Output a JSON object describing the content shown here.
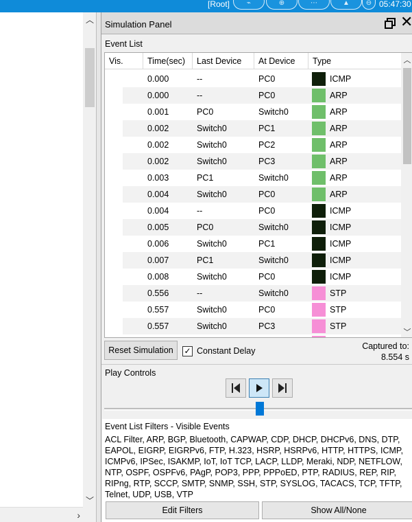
{
  "topbar": {
    "root_label": "[Root]",
    "clock": "05:47:30"
  },
  "panel": {
    "title": "Simulation Panel"
  },
  "event_list": {
    "label": "Event List",
    "columns": [
      "Vis.",
      "Time(sec)",
      "Last Device",
      "At Device",
      "Type"
    ],
    "rows": [
      {
        "time": "0.000",
        "last": "--",
        "at": "PC0",
        "type": "ICMP",
        "color": "#0f1f0a"
      },
      {
        "time": "0.000",
        "last": "--",
        "at": "PC0",
        "type": "ARP",
        "color": "#6fbf6a"
      },
      {
        "time": "0.001",
        "last": "PC0",
        "at": "Switch0",
        "type": "ARP",
        "color": "#6fbf6a"
      },
      {
        "time": "0.002",
        "last": "Switch0",
        "at": "PC1",
        "type": "ARP",
        "color": "#6fbf6a"
      },
      {
        "time": "0.002",
        "last": "Switch0",
        "at": "PC2",
        "type": "ARP",
        "color": "#6fbf6a"
      },
      {
        "time": "0.002",
        "last": "Switch0",
        "at": "PC3",
        "type": "ARP",
        "color": "#6fbf6a"
      },
      {
        "time": "0.003",
        "last": "PC1",
        "at": "Switch0",
        "type": "ARP",
        "color": "#6fbf6a"
      },
      {
        "time": "0.004",
        "last": "Switch0",
        "at": "PC0",
        "type": "ARP",
        "color": "#6fbf6a"
      },
      {
        "time": "0.004",
        "last": "--",
        "at": "PC0",
        "type": "ICMP",
        "color": "#0f1f0a"
      },
      {
        "time": "0.005",
        "last": "PC0",
        "at": "Switch0",
        "type": "ICMP",
        "color": "#0f1f0a"
      },
      {
        "time": "0.006",
        "last": "Switch0",
        "at": "PC1",
        "type": "ICMP",
        "color": "#0f1f0a"
      },
      {
        "time": "0.007",
        "last": "PC1",
        "at": "Switch0",
        "type": "ICMP",
        "color": "#0f1f0a"
      },
      {
        "time": "0.008",
        "last": "Switch0",
        "at": "PC0",
        "type": "ICMP",
        "color": "#0f1f0a"
      },
      {
        "time": "0.556",
        "last": "--",
        "at": "Switch0",
        "type": "STP",
        "color": "#f68fd6"
      },
      {
        "time": "0.557",
        "last": "Switch0",
        "at": "PC0",
        "type": "STP",
        "color": "#f68fd6"
      },
      {
        "time": "0.557",
        "last": "Switch0",
        "at": "PC3",
        "type": "STP",
        "color": "#f68fd6"
      }
    ]
  },
  "controls": {
    "reset_label": "Reset Simulation",
    "constant_delay_label": "Constant Delay",
    "constant_delay_checked": true,
    "captured_label": "Captured to:",
    "captured_value": "8.554 s"
  },
  "play_controls": {
    "label": "Play Controls"
  },
  "filters": {
    "label": "Event List Filters - Visible Events",
    "text": "ACL Filter, ARP, BGP, Bluetooth, CAPWAP, CDP, DHCP, DHCPv6, DNS, DTP,\nEAPOL, EIGRP, EIGRPv6, FTP, H.323, HSRP, HSRPv6, HTTP, HTTPS, ICMP,\nICMPv6, IPSec, ISAKMP, IoT, IoT TCP, LACP, LLDP, Meraki, NDP, NETFLOW,\nNTP, OSPF, OSPFv6, PAgP, POP3, PPP, PPPoED, PTP, RADIUS, REP, RIP,\nRIPng, RTP, SCCP, SMTP, SNMP, SSH, STP, SYSLOG, TACACS, TCP, TFTP,\nTelnet, UDP, USB, VTP",
    "edit_label": "Edit Filters",
    "show_label": "Show All/None"
  }
}
